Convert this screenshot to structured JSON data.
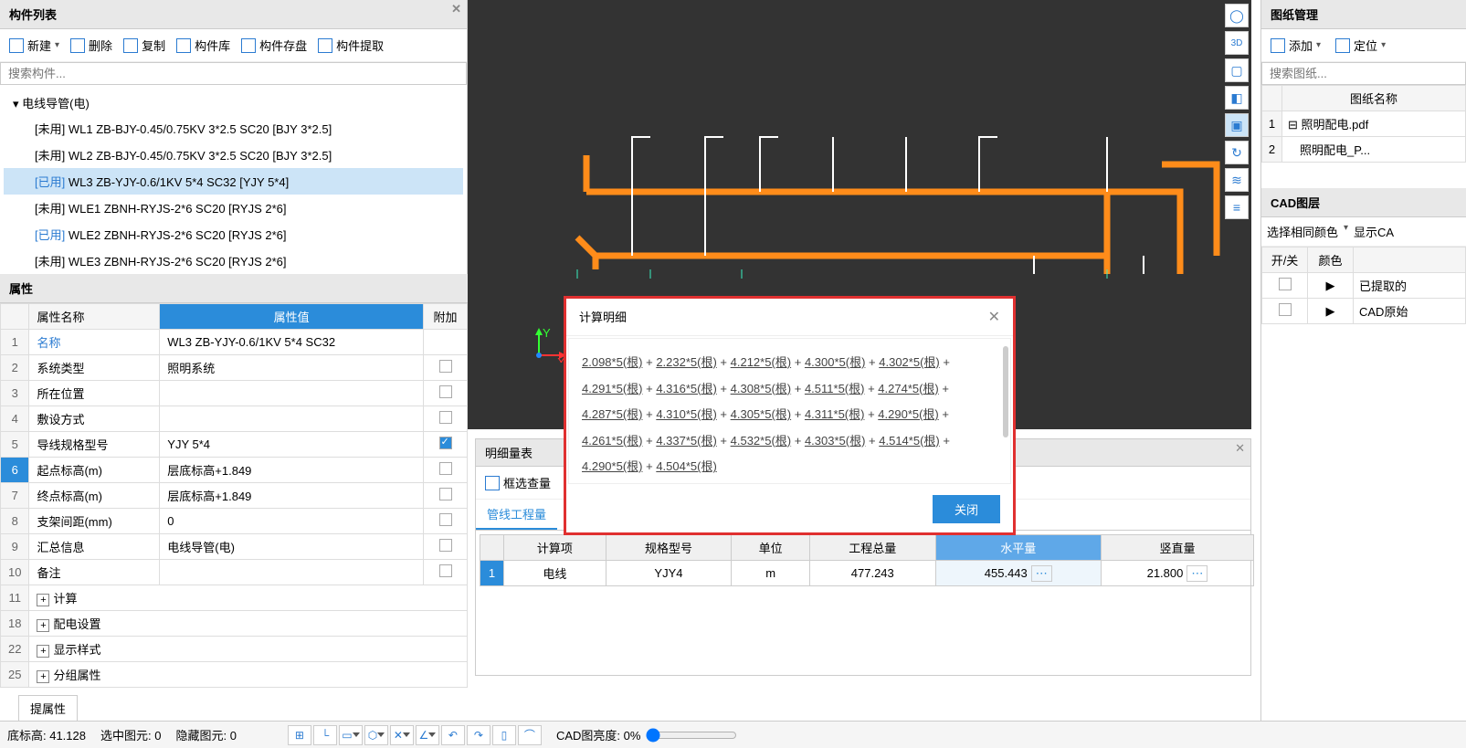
{
  "leftPanel": {
    "title": "构件列表",
    "toolbar": [
      "新建",
      "删除",
      "复制",
      "构件库",
      "构件存盘",
      "构件提取"
    ],
    "searchPlaceholder": "搜索构件...",
    "treeRoot": "电线导管(电)",
    "items": [
      {
        "prefix": "[未用]",
        "text": "WL1 ZB-BJY-0.45/0.75KV 3*2.5 SC20 [BJY 3*2.5]",
        "sel": false,
        "used": false
      },
      {
        "prefix": "[未用]",
        "text": "WL2 ZB-BJY-0.45/0.75KV 3*2.5 SC20 [BJY 3*2.5]",
        "sel": false,
        "used": false
      },
      {
        "prefix": "[已用]",
        "text": "WL3 ZB-YJY-0.6/1KV 5*4 SC32 [YJY  5*4]",
        "sel": true,
        "used": true
      },
      {
        "prefix": "[未用]",
        "text": "WLE1 ZBNH-RYJS-2*6 SC20 [RYJS 2*6]",
        "sel": false,
        "used": false
      },
      {
        "prefix": "[已用]",
        "text": "WLE2 ZBNH-RYJS-2*6 SC20 [RYJS 2*6]",
        "sel": false,
        "used": true
      },
      {
        "prefix": "[未用]",
        "text": "WLE3 ZBNH-RYJS-2*6 SC20 [RYJS 2*6]",
        "sel": false,
        "used": false
      }
    ]
  },
  "props": {
    "title": "属性",
    "headers": {
      "name": "属性名称",
      "value": "属性值",
      "extra": "附加"
    },
    "rows": [
      {
        "n": "1",
        "name": "名称",
        "value": "WL3 ZB-YJY-0.6/1KV 5*4 SC32",
        "nameBlue": true,
        "chk": ""
      },
      {
        "n": "2",
        "name": "系统类型",
        "value": "照明系统",
        "chk": "off"
      },
      {
        "n": "3",
        "name": "所在位置",
        "value": "",
        "chk": "off"
      },
      {
        "n": "4",
        "name": "敷设方式",
        "value": "",
        "chk": "off"
      },
      {
        "n": "5",
        "name": "导线规格型号",
        "value": "YJY  5*4",
        "chk": "on"
      },
      {
        "n": "6",
        "name": "起点标高(m)",
        "value": "层底标高+1.849",
        "chk": "off",
        "selRow": true
      },
      {
        "n": "7",
        "name": "终点标高(m)",
        "value": "层底标高+1.849",
        "chk": "off"
      },
      {
        "n": "8",
        "name": "支架间距(mm)",
        "value": "0",
        "chk": "off"
      },
      {
        "n": "9",
        "name": "汇总信息",
        "value": "电线导管(电)",
        "chk": "off"
      },
      {
        "n": "10",
        "name": "备注",
        "value": "",
        "chk": "off"
      },
      {
        "n": "11",
        "name": "计算",
        "expander": true
      },
      {
        "n": "18",
        "name": "配电设置",
        "expander": true
      },
      {
        "n": "22",
        "name": "显示样式",
        "expander": true
      },
      {
        "n": "25",
        "name": "分组属性",
        "expander": true,
        "cut": true
      }
    ],
    "extractBtn": "提属性"
  },
  "rightPanel": {
    "title": "图纸管理",
    "btns": [
      "添加",
      "定位"
    ],
    "searchPlaceholder": "搜索图纸...",
    "colHeader": "图纸名称",
    "rows": [
      {
        "n": "1",
        "name": "照明配电.pdf",
        "exp": true
      },
      {
        "n": "2",
        "name": "照明配电_P...",
        "exp": false
      }
    ],
    "cadLayer": {
      "title": "CAD图层",
      "optA": "选择相同颜色",
      "optB": "显示CA",
      "hdr1": "开/关",
      "hdr2": "颜色",
      "row1": "已提取的",
      "row2": "CAD原始"
    }
  },
  "detail": {
    "title": "明细量表",
    "toolBtn": "框选查量",
    "tab": "管线工程量",
    "headers": [
      "计算项",
      "规格型号",
      "单位",
      "工程总量",
      "水平量",
      "竖直量"
    ],
    "row": {
      "n": "1",
      "a": "电线",
      "b": "YJY4",
      "c": "m",
      "d": "477.243",
      "e": "455.443",
      "f": "21.800"
    }
  },
  "dialog": {
    "title": "计算明细",
    "segments": [
      "2.098*5(根)",
      "2.232*5(根)",
      "4.212*5(根)",
      "4.300*5(根)",
      "4.302*5(根)",
      "4.291*5(根)",
      "4.316*5(根)",
      "4.308*5(根)",
      "4.511*5(根)",
      "4.274*5(根)",
      "4.287*5(根)",
      "4.310*5(根)",
      "4.305*5(根)",
      "4.311*5(根)",
      "4.290*5(根)",
      "4.261*5(根)",
      "4.337*5(根)",
      "4.532*5(根)",
      "4.303*5(根)",
      "4.514*5(根)",
      "4.290*5(根)",
      "4.504*5(根)"
    ],
    "closeBtn": "关闭"
  },
  "status": {
    "floor": "底标高: 41.128",
    "sel": "选中图元: 0",
    "hidden": "隐藏图元: 0",
    "cadBright": "CAD图亮度: 0%"
  },
  "chart_data": {
    "type": "table",
    "title": "管线工程量明细",
    "columns": [
      "计算项",
      "规格型号",
      "单位",
      "工程总量",
      "水平量",
      "竖直量"
    ],
    "rows": [
      [
        "电线",
        "YJY4",
        "m",
        477.243,
        455.443,
        21.8
      ]
    ]
  }
}
